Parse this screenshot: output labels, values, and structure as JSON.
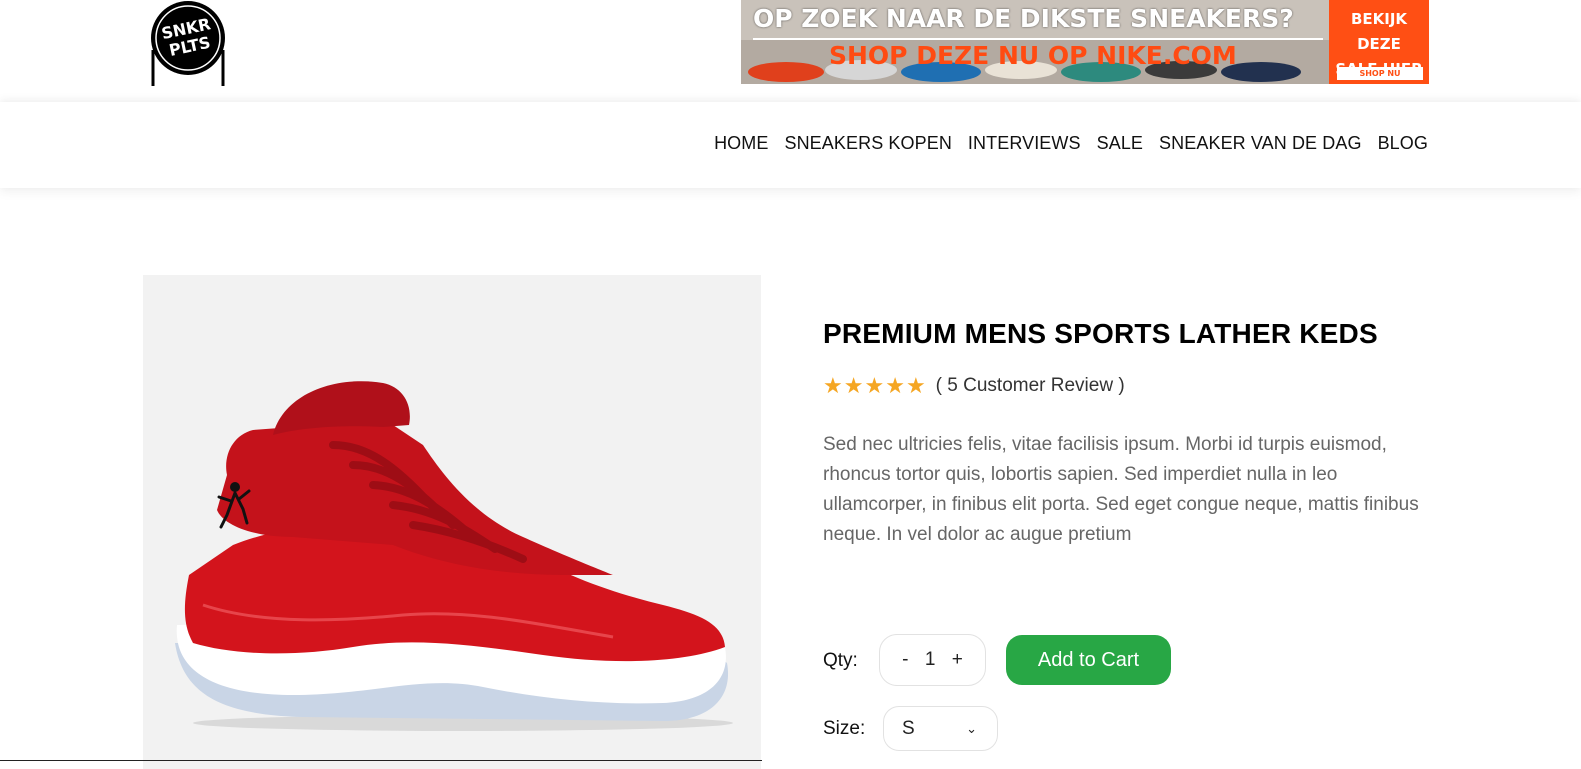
{
  "header": {
    "logo": {
      "text_line1": "SNKR",
      "text_line2": "PLTS"
    },
    "banner": {
      "headline": "OP ZOEK NAAR DE DIKSTE SNEAKERS?",
      "subline": "SHOP DEZE NU OP NIKE.COM",
      "cta_line1": "BEKIJK DEZE",
      "cta_line2": "SALE HIER",
      "cta_button": "SHOP NU",
      "accent_color": "#ff4f14"
    }
  },
  "nav": {
    "items": [
      {
        "label": "HOME"
      },
      {
        "label": "SNEAKERS KOPEN"
      },
      {
        "label": "INTERVIEWS"
      },
      {
        "label": "SALE"
      },
      {
        "label": "SNEAKER VAN DE DAG"
      },
      {
        "label": "BLOG"
      }
    ]
  },
  "product": {
    "title": "PREMIUM MENS SPORTS LATHER KEDS",
    "rating": 5,
    "rating_max": 5,
    "review_text": "( 5 Customer Review )",
    "description": "Sed nec ultricies felis, vitae facilisis ipsum. Morbi id turpis euismod, rhoncus tortor quis, lobortis sapien. Sed imperdiet nulla in leo ullamcorper, in finibus elit porta. Sed eget congue neque, mattis finibus neque. In vel dolor ac augue pretium",
    "image_icon": "red-high-top-sneaker",
    "qty": {
      "label": "Qty:",
      "decrement": "-",
      "value": "1",
      "increment": "+"
    },
    "add_to_cart": "Add to Cart",
    "size": {
      "label": "Size:",
      "value": "S"
    },
    "colors": {
      "star": "#f5a623",
      "cart_button": "#28a745",
      "shoe": "#d3141c"
    }
  }
}
